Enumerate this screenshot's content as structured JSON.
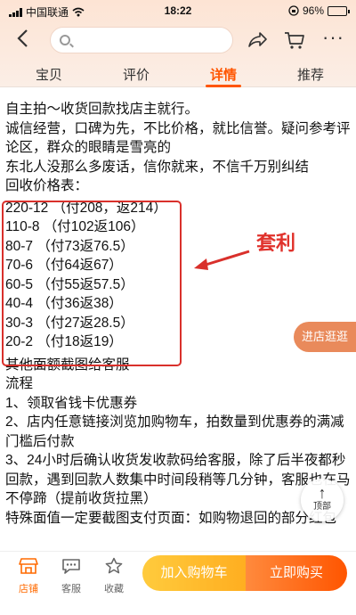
{
  "status_bar": {
    "carrier": "中国联通",
    "time": "18:22",
    "battery": "96%",
    "battery_level": 0.96
  },
  "tabs": [
    {
      "label": "宝贝"
    },
    {
      "label": "评价"
    },
    {
      "label": "详情"
    },
    {
      "label": "推荐"
    }
  ],
  "content": {
    "intro_lines": [
      "自主拍～收货回款找店主就行。",
      "诚信经营，口碑为先，不比价格，就比信誉。疑问参考评论区，群众的眼睛是雪亮的",
      "东北人没那么多废话，信你就来，不信千万别纠结",
      "回收价格表："
    ],
    "prices": [
      "220-12 （付208，返214）",
      "110-8 （付102返106）",
      "80-7 （付73返76.5）",
      "70-6 （付64返67）",
      "60-5 （付55返57.5）",
      "40-4 （付36返38）",
      "30-3 （付27返28.5）",
      "20-2 （付18返19）"
    ],
    "after_lines": [
      "其他面额截图给客服",
      "流程",
      "1、领取省钱卡优惠券",
      "2、店内任意链接浏览加购物车，拍数量到优惠券的满减门槛后付款",
      "3、24小时后确认收货发收款码给客服，除了后半夜都秒回款，遇到回款人数集中时间段稍等几分钟，客服也在马不停蹄（提前收货拉黑）",
      "特殊面值一定要截图支付页面：如购物退回的部分红包"
    ]
  },
  "annotation": {
    "label": "套利"
  },
  "floating": {
    "store_button": "进店逛逛",
    "top_button": "顶部"
  },
  "bottom_bar": {
    "shop": "店铺",
    "service": "客服",
    "favorite": "收藏",
    "add_to_cart": "加入购物车",
    "buy_now": "立即购买"
  },
  "colors": {
    "accent": "#ff5500",
    "annotation_red": "#d9302b",
    "cart_yellow": "#ffb52a"
  }
}
